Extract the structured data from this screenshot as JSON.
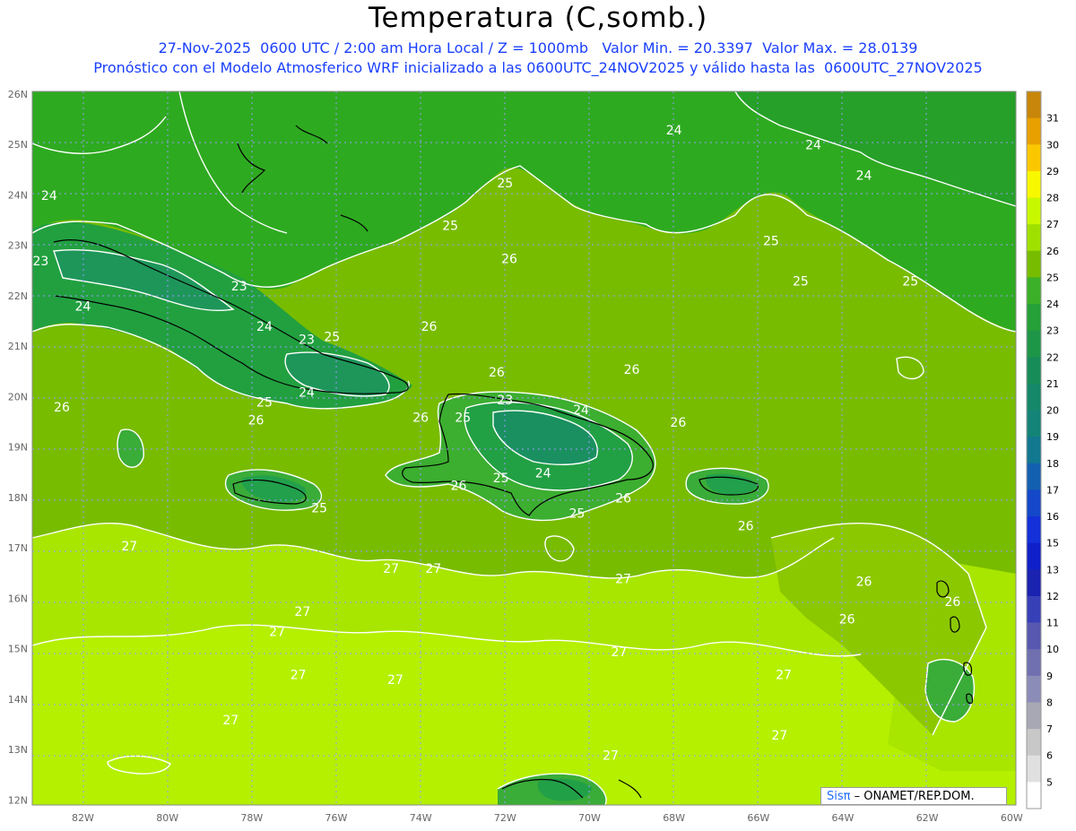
{
  "header": {
    "title": "Temperatura (C,somb.)",
    "line1": "27-Nov-2025  0600 UTC / 2:00 am Hora Local / Z = 1000mb   Valor Min. = 20.3397  Valor Max. = 28.0139",
    "line2": "Pronóstico con el Modelo Atmosferico WRF inicializado a las 0600UTC_24NOV2025 y válido hasta las  0600UTC_27NOV2025"
  },
  "map": {
    "lat_labels": [
      "26N",
      "25N",
      "24N",
      "23N",
      "22N",
      "21N",
      "20N",
      "19N",
      "18N",
      "17N",
      "16N",
      "15N",
      "14N",
      "13N",
      "12N"
    ],
    "lon_labels": [
      "82W",
      "80W",
      "78W",
      "76W",
      "74W",
      "72W",
      "70W",
      "68W",
      "66W",
      "64W",
      "62W",
      "60W"
    ],
    "contour_labels": [
      {
        "text": "24",
        "lon": -68.0,
        "lat": 25.2
      },
      {
        "text": "24",
        "lon": -64.7,
        "lat": 24.9
      },
      {
        "text": "24",
        "lon": -63.5,
        "lat": 24.3
      },
      {
        "text": "24",
        "lon": -82.8,
        "lat": 23.9
      },
      {
        "text": "25",
        "lon": -73.3,
        "lat": 23.3
      },
      {
        "text": "25",
        "lon": -72.0,
        "lat": 24.15
      },
      {
        "text": "25",
        "lon": -65.7,
        "lat": 23.0
      },
      {
        "text": "26",
        "lon": -71.9,
        "lat": 22.65
      },
      {
        "text": "25",
        "lon": -65.0,
        "lat": 22.2
      },
      {
        "text": "25",
        "lon": -62.4,
        "lat": 22.2
      },
      {
        "text": "23",
        "lon": -83.0,
        "lat": 22.6
      },
      {
        "text": "23",
        "lon": -78.3,
        "lat": 22.1
      },
      {
        "text": "24",
        "lon": -82.0,
        "lat": 21.7
      },
      {
        "text": "24",
        "lon": -77.7,
        "lat": 21.3
      },
      {
        "text": "23",
        "lon": -76.7,
        "lat": 21.05
      },
      {
        "text": "25",
        "lon": -76.1,
        "lat": 21.1
      },
      {
        "text": "26",
        "lon": -73.8,
        "lat": 21.3
      },
      {
        "text": "26",
        "lon": -72.2,
        "lat": 20.4
      },
      {
        "text": "26",
        "lon": -69.0,
        "lat": 20.45
      },
      {
        "text": "24",
        "lon": -76.7,
        "lat": 20.0
      },
      {
        "text": "25",
        "lon": -77.7,
        "lat": 19.8
      },
      {
        "text": "26",
        "lon": -82.5,
        "lat": 19.7
      },
      {
        "text": "26",
        "lon": -77.9,
        "lat": 19.45
      },
      {
        "text": "23",
        "lon": -72.0,
        "lat": 19.85
      },
      {
        "text": "24",
        "lon": -70.2,
        "lat": 19.65
      },
      {
        "text": "25",
        "lon": -73.0,
        "lat": 19.5
      },
      {
        "text": "26",
        "lon": -74.0,
        "lat": 19.5
      },
      {
        "text": "26",
        "lon": -67.9,
        "lat": 19.4
      },
      {
        "text": "24",
        "lon": -71.1,
        "lat": 18.4
      },
      {
        "text": "25",
        "lon": -72.1,
        "lat": 18.3
      },
      {
        "text": "26",
        "lon": -73.1,
        "lat": 18.15
      },
      {
        "text": "25",
        "lon": -76.4,
        "lat": 17.7
      },
      {
        "text": "25",
        "lon": -70.3,
        "lat": 17.6
      },
      {
        "text": "26",
        "lon": -69.2,
        "lat": 17.9
      },
      {
        "text": "26",
        "lon": -66.3,
        "lat": 17.35
      },
      {
        "text": "27",
        "lon": -80.9,
        "lat": 16.95
      },
      {
        "text": "27",
        "lon": -74.7,
        "lat": 16.5
      },
      {
        "text": "27",
        "lon": -73.7,
        "lat": 16.5
      },
      {
        "text": "27",
        "lon": -69.2,
        "lat": 16.3
      },
      {
        "text": "27",
        "lon": -76.8,
        "lat": 15.65
      },
      {
        "text": "27",
        "lon": -77.4,
        "lat": 15.25
      },
      {
        "text": "26",
        "lon": -63.5,
        "lat": 16.25
      },
      {
        "text": "26",
        "lon": -61.4,
        "lat": 15.85
      },
      {
        "text": "26",
        "lon": -63.9,
        "lat": 15.5
      },
      {
        "text": "27",
        "lon": -69.3,
        "lat": 14.85
      },
      {
        "text": "27",
        "lon": -76.9,
        "lat": 14.4
      },
      {
        "text": "27",
        "lon": -74.6,
        "lat": 14.3
      },
      {
        "text": "27",
        "lon": -65.4,
        "lat": 14.4
      },
      {
        "text": "27",
        "lon": -78.5,
        "lat": 13.5
      },
      {
        "text": "27",
        "lon": -65.5,
        "lat": 13.2
      },
      {
        "text": "27",
        "lon": -69.5,
        "lat": 12.8
      }
    ]
  },
  "colorbar": {
    "labels": [
      "31",
      "30",
      "29",
      "28",
      "27",
      "26",
      "25",
      "24",
      "23",
      "22",
      "21",
      "20",
      "19",
      "18",
      "17",
      "16",
      "15",
      "13",
      "12",
      "11",
      "10",
      "9",
      "8",
      "7",
      "6",
      "5"
    ],
    "colors": [
      "#c8860a",
      "#e8a000",
      "#fbc800",
      "#f8f800",
      "#c8f800",
      "#a0e000",
      "#78bc00",
      "#3cb028",
      "#26a038",
      "#1e9648",
      "#188c58",
      "#148868",
      "#148478",
      "#127890",
      "#1460b0",
      "#1448c8",
      "#1430d8",
      "#1020c8",
      "#1a22b0",
      "#3840b8",
      "#5858b0",
      "#7070b0",
      "#8c8cb8",
      "#a8a8b4",
      "#c8c8c8",
      "#e0e0e0",
      "#ffffff"
    ]
  },
  "credit": {
    "brand": "Sisπ",
    "rest": " – ONAMET/REP.DOM."
  }
}
